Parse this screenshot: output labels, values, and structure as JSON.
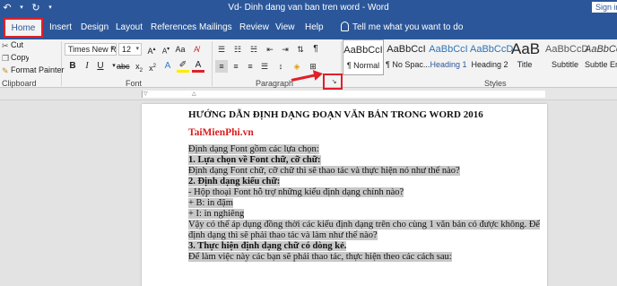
{
  "title_bar": {
    "undo_icon": "undo-icon",
    "redo_icon": "redo-icon",
    "document_title": "Vd- Dinh dang van ban tren word  -  Word",
    "sign_in": "Sign in"
  },
  "tabs": [
    "Home",
    "Insert",
    "Design",
    "Layout",
    "References",
    "Mailings",
    "Review",
    "View",
    "Help"
  ],
  "tell_me": "Tell me what you want to do",
  "clipboard": {
    "cut": "Cut",
    "copy": "Copy",
    "format_painter": "Format Painter",
    "label": "Clipboard"
  },
  "font": {
    "font_name": "Times New Ro",
    "font_size": "12",
    "label": "Font"
  },
  "paragraph": {
    "label": "Paragraph"
  },
  "styles": {
    "label": "Styles",
    "items": [
      {
        "preview": "AaBbCcI",
        "name": "¶ Normal"
      },
      {
        "preview": "AaBbCcI",
        "name": "¶ No Spac..."
      },
      {
        "preview": "AaBbCcI",
        "name": "Heading 1"
      },
      {
        "preview": "AaBbCcD",
        "name": "Heading 2"
      },
      {
        "preview": "AaB",
        "name": "Title"
      },
      {
        "preview": "AaBbCcD",
        "name": "Subtitle"
      },
      {
        "preview": "AaBbCcD",
        "name": "Subtle Em"
      }
    ]
  },
  "document": {
    "heading": "HƯỚNG DẪN ĐỊNH DẠNG ĐOẠN VĂN BẢN TRONG WORD 2016",
    "brand": "TaiMienPhi.vn",
    "lines": [
      "Định dạng Font gồm các lựa chọn:",
      "1. Lựa chọn về Font chữ, cỡ chữ:",
      "Định dạng Font chữ, cỡ chữ thì sẽ thao tác và thực hiện nó như thế nào?",
      "2. Định dạng kiểu chữ:",
      "- Hộp thoại Font hỗ trợ những kiểu định dạng chính nào?",
      "+ B: in đậm",
      "+ I: in nghiêng",
      "Vậy có thể áp dụng đồng thời các kiểu định dạng trên cho cùng 1 văn bản có được không. Để",
      "định dạng thì sẽ phải thao tác và làm như thế nào?",
      "3. Thực hiện định dạng chữ có dòng kẻ.",
      "Để làm việc này các bạn sẽ phải thao tác, thực hiện theo các cách sau:"
    ]
  },
  "colors": {
    "word_blue": "#2b579a",
    "annotation_red": "#e0202a",
    "highlight": "#c8c8c8"
  }
}
